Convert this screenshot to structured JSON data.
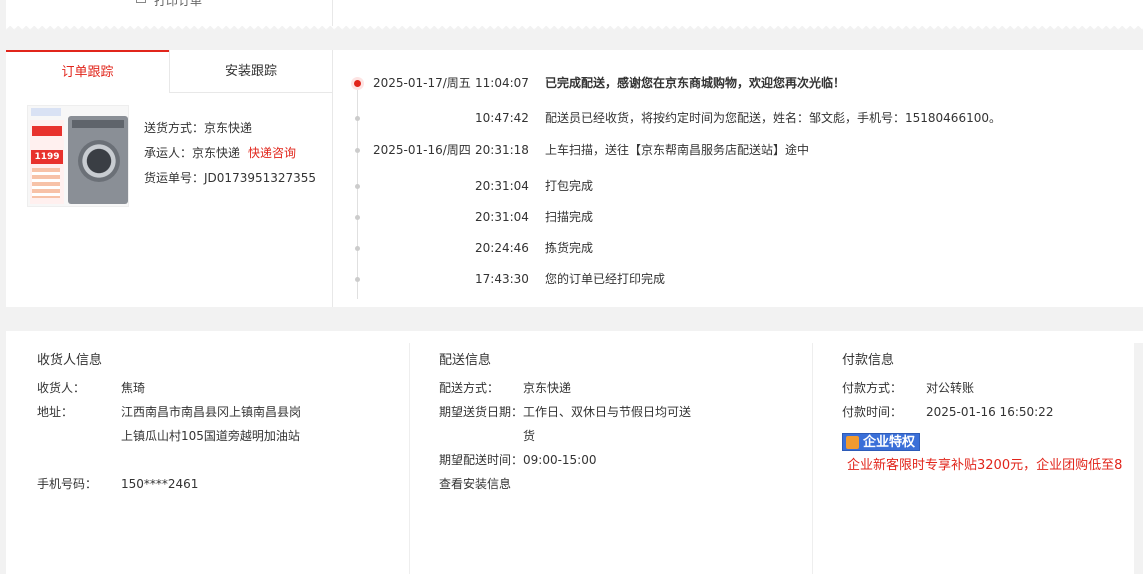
{
  "top": {
    "cut_text": "打印订单"
  },
  "tabs": [
    {
      "label": "订单跟踪",
      "active": true
    },
    {
      "label": "安装跟踪",
      "active": false
    }
  ],
  "shipping": {
    "method_label": "送货方式：",
    "method_value": "京东快递",
    "carrier_label": "承运人：",
    "carrier_value": "京东快递",
    "carrier_link": "快递咨询",
    "tracking_label": "货运单号：",
    "tracking_value": "JD0173951327355"
  },
  "product": {
    "price_tag": "1199"
  },
  "timeline": [
    {
      "date": "2025-01-17/周五",
      "time": "11:04:07",
      "msg": "已完成配送，感谢您在京东商城购物，欢迎您再次光临！"
    },
    {
      "date": "",
      "time": "10:47:42",
      "msg": "配送员已经收货，将按约定时间为您配送，姓名：邹文彪，手机号：15180466100。"
    },
    {
      "date": "2025-01-16/周四",
      "time": "20:31:18",
      "msg": "上车扫描，送往【京东帮南昌服务店配送站】途中"
    },
    {
      "date": "",
      "time": "20:31:04",
      "msg": "打包完成"
    },
    {
      "date": "",
      "time": "20:31:04",
      "msg": "扫描完成"
    },
    {
      "date": "",
      "time": "20:24:46",
      "msg": "拣货完成"
    },
    {
      "date": "",
      "time": "17:43:30",
      "msg": "您的订单已经打印完成"
    }
  ],
  "consignee": {
    "title": "收货人信息",
    "name_label": "收货人：",
    "name_value": "焦琦",
    "addr_label": "地址：",
    "addr_value": "江西南昌市南昌县冈上镇南昌县岗上镇瓜山村105国道旁越明加油站",
    "phone_label": "手机号码：",
    "phone_value": "150****2461"
  },
  "delivery": {
    "title": "配送信息",
    "method_label": "配送方式：",
    "method_value": "京东快递",
    "date_label": "期望送货日期：",
    "date_value": "工作日、双休日与节假日均可送货",
    "time_label": "期望配送时间：",
    "time_value": "09:00-15:00",
    "install_link": "查看安装信息"
  },
  "payment": {
    "title": "付款信息",
    "method_label": "付款方式：",
    "method_value": "对公转账",
    "time_label": "付款时间：",
    "time_value": "2025-01-16 16:50:22",
    "badge": "企业特权",
    "promo": "企业新客限时专享补贴3200元，企业团购低至8"
  },
  "colors": {
    "accent": "#e1251b",
    "badge_bg": "#3a6fd8"
  }
}
